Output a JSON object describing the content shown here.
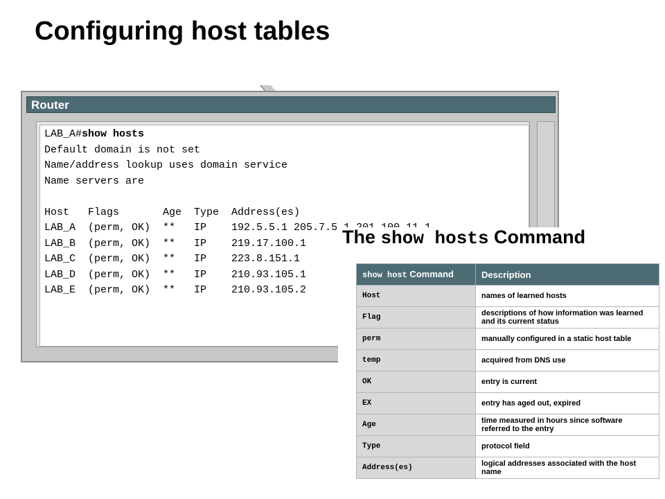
{
  "title": "Configuring host tables",
  "router": {
    "title": "Router",
    "terminal_lines": [
      {
        "prompt": "LAB_A#",
        "command": "show hosts"
      },
      {
        "text": "Default domain is not set"
      },
      {
        "text": "Name/address lookup uses domain service"
      },
      {
        "text": "Name servers are"
      },
      {
        "text": ""
      },
      {
        "text": "Host   Flags       Age  Type  Address(es)"
      },
      {
        "text": "LAB_A  (perm, OK)  **   IP    192.5.5.1 205.7.5.1 201.100.11.1"
      },
      {
        "text": "LAB_B  (perm, OK)  **   IP    219.17.100.1"
      },
      {
        "text": "LAB_C  (perm, OK)  **   IP    223.8.151.1"
      },
      {
        "text": "LAB_D  (perm, OK)  **   IP    210.93.105.1"
      },
      {
        "text": "LAB_E  (perm, OK)  **   IP    210.93.105.2"
      }
    ]
  },
  "overlay": {
    "heading_prefix": "The ",
    "heading_code": "show hosts",
    "heading_suffix": " Command",
    "table": {
      "header_code": "show host",
      "header_cmd_suffix": " Command",
      "header_desc": "Description",
      "rows": [
        {
          "cmd": "Host",
          "desc": "names of learned hosts"
        },
        {
          "cmd": "Flag",
          "desc": "descriptions of how information was learned and its current status"
        },
        {
          "cmd": "perm",
          "desc": "manually configured in a static host table"
        },
        {
          "cmd": "temp",
          "desc": "acquired from DNS use"
        },
        {
          "cmd": "OK",
          "desc": "entry is current"
        },
        {
          "cmd": "EX",
          "desc": "entry has aged out, expired"
        },
        {
          "cmd": "Age",
          "desc": "time measured in hours since software referred to the entry"
        },
        {
          "cmd": "Type",
          "desc": "protocol field"
        },
        {
          "cmd": "Address(es)",
          "desc": "logical addresses associated with the host name"
        }
      ]
    }
  },
  "colors": {
    "titlebar": "#4d6b73",
    "frame": "#c7c7c7",
    "table_cmd_bg": "#d8d8d8"
  }
}
